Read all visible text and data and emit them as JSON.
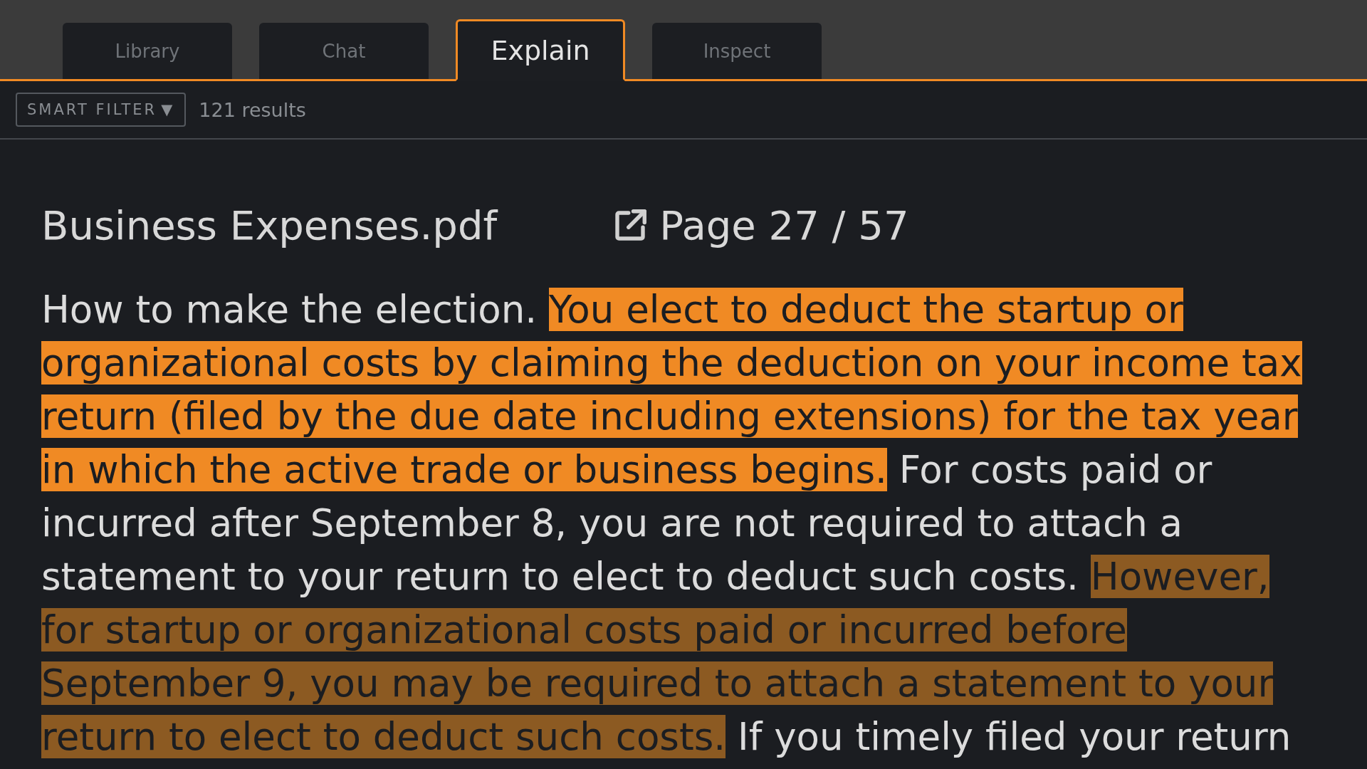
{
  "tabs": [
    {
      "label": "Library",
      "selected": false
    },
    {
      "label": "Chat",
      "selected": false
    },
    {
      "label": "Explain",
      "selected": true
    },
    {
      "label": "Inspect",
      "selected": false
    }
  ],
  "filter": {
    "label": "SMART FILTER",
    "caret": "▼",
    "results": "121 results"
  },
  "document": {
    "title": "Business Expenses.pdf",
    "page": "Page 27 / 57"
  },
  "passage": [
    {
      "text": "How to make the election. ",
      "kind": "plain"
    },
    {
      "text": "You elect to deduct the startup or organizational costs by claiming the deduction on your income tax return (filed by the due date including extensions) for the tax year in which the active trade or business begins.",
      "kind": "strong"
    },
    {
      "text": " For costs paid or incurred after September 8, you are not required to attach a statement to your return to elect to deduct such costs. ",
      "kind": "plain"
    },
    {
      "text": "However, for startup or organizational costs paid or incurred before September 9, you may be required to attach a statement to your return to elect to deduct such costs.",
      "kind": "weak"
    },
    {
      "text": " If you timely filed your return",
      "kind": "plain"
    }
  ]
}
